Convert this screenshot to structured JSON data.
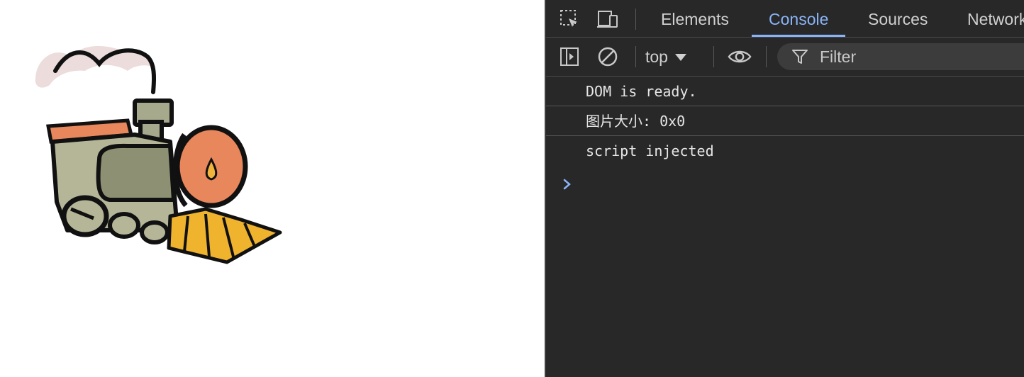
{
  "devtools": {
    "tabs": [
      {
        "label": "Elements",
        "active": false
      },
      {
        "label": "Console",
        "active": true
      },
      {
        "label": "Sources",
        "active": false
      },
      {
        "label": "Network",
        "active": false
      }
    ],
    "toolbar": {
      "context": "top",
      "filter_placeholder": "Filter"
    },
    "console": {
      "messages": [
        "DOM is ready.",
        "图片大小: 0x0",
        "script injected"
      ]
    },
    "colors": {
      "accent": "#8ab4f8",
      "background": "#282828"
    }
  },
  "page": {
    "image": {
      "icon": "train-illustration"
    }
  }
}
